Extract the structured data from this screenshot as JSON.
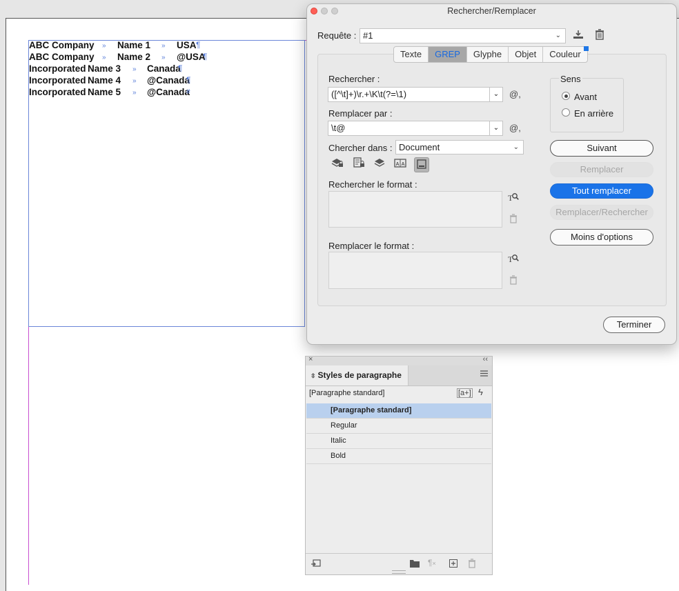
{
  "document": {
    "lines": [
      {
        "c1": "ABC Company",
        "c2": "Name 1",
        "c3": "USA",
        "end": "¶"
      },
      {
        "c1": "ABC Company",
        "c2": "Name 2",
        "c3": "@USA",
        "end": "¶"
      },
      {
        "c1": "Incorporated",
        "c2": "Name 3",
        "c3": "Canada",
        "end": "¶"
      },
      {
        "c1": "Incorporated",
        "c2": "Name 4",
        "c3": "@Canada",
        "end": "¶"
      },
      {
        "c1": "Incorporated",
        "c2": "Name 5",
        "c3": "@Canada",
        "end": "#"
      }
    ],
    "tab_marker": "»"
  },
  "dialog": {
    "title": "Rechercher/Remplacer",
    "query_label": "Requête :",
    "query_value": "#1",
    "tabs": [
      "Texte",
      "GREP",
      "Glyphe",
      "Objet",
      "Couleur"
    ],
    "active_tab": "GREP",
    "find_label": "Rechercher :",
    "find_value": "([^\\t]+)\\r.+\\K\\t(?=\\1)",
    "replace_label": "Remplacer par :",
    "replace_value": "\\t@",
    "search_in_label": "Chercher dans :",
    "search_in_value": "Document",
    "find_format_label": "Rechercher le format :",
    "replace_format_label": "Remplacer le format :",
    "direction": {
      "title": "Sens",
      "forward": "Avant",
      "backward": "En arrière",
      "selected": "Avant"
    },
    "buttons": {
      "next": "Suivant",
      "replace": "Remplacer",
      "replace_all": "Tout remplacer",
      "replace_find": "Remplacer/Rechercher",
      "fewer_options": "Moins d'options",
      "done": "Terminer"
    },
    "special_char_symbol": "@,"
  },
  "styles_panel": {
    "tab_label": "Styles de paragraphe",
    "current_style": "[Paragraphe standard]",
    "new_from_selection": "[a+]",
    "items": [
      "[Paragraphe standard]",
      "Regular",
      "Italic",
      "Bold"
    ],
    "selected": "[Paragraphe standard]"
  },
  "colors": {
    "accent": "#1a73e8",
    "frame_magenta": "#c94fd0",
    "frame_blue": "#6a86d8",
    "selected_row": "#b9d0ee"
  }
}
